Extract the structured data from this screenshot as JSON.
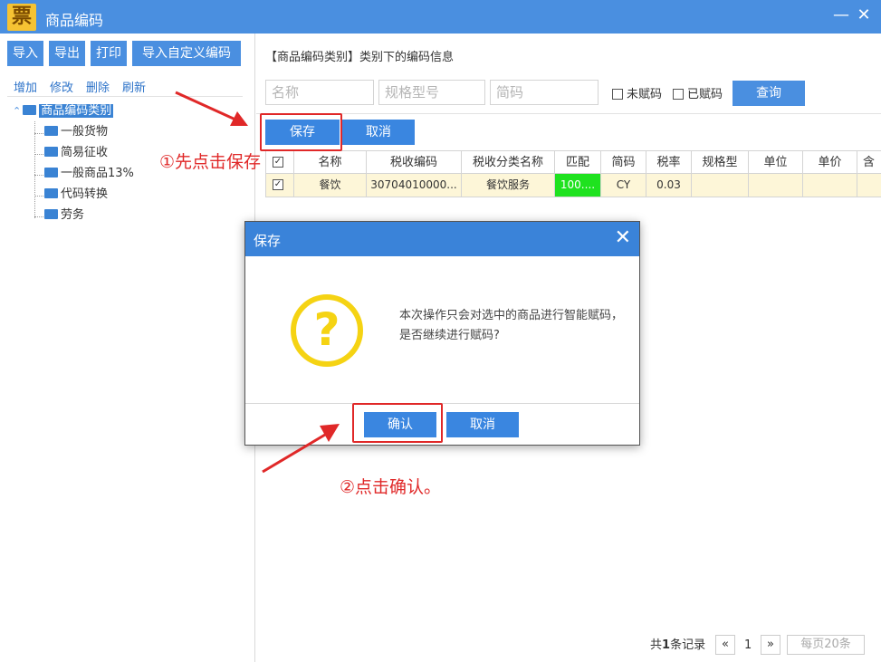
{
  "window": {
    "logo_text": "票",
    "title": "商品编码",
    "minimize": "—",
    "close": "✕"
  },
  "toolbar": {
    "import": "导入",
    "export": "导出",
    "print": "打印",
    "import_custom": "导入自定义编码"
  },
  "actions": {
    "add": "增加",
    "edit": "修改",
    "delete": "删除",
    "refresh": "刷新"
  },
  "tree": {
    "root": "商品编码类别",
    "expander": "⌃",
    "children": [
      "一般货物",
      "简易征收",
      "一般商品13%",
      "代码转换",
      "劳务"
    ]
  },
  "main": {
    "section_title": "【商品编码类别】类别下的编码信息",
    "search": {
      "name_placeholder": "名称",
      "spec_placeholder": "规格型号",
      "short_placeholder": "简码",
      "unassigned_label": "未赋码",
      "assigned_label": "已赋码",
      "query_label": "查询"
    },
    "save_label": "保存",
    "cancel_label": "取消",
    "grid": {
      "columns": [
        "名称",
        "税收编码",
        "税收分类名称",
        "匹配",
        "简码",
        "税率",
        "规格型",
        "单位",
        "单价",
        "含"
      ],
      "rows": [
        {
          "checked": "✓",
          "cells": [
            "餐饮",
            "30704010000...",
            "餐饮服务",
            "100....",
            "CY",
            "0.03",
            "",
            "",
            "",
            ""
          ]
        }
      ],
      "header_check": "✓"
    },
    "pager": {
      "total_prefix": "共",
      "total_count": "1",
      "total_suffix": "条记录",
      "prev": "«",
      "page": "1",
      "next": "»",
      "page_size": "每页20条"
    }
  },
  "dialog": {
    "title": "保存",
    "close": "✕",
    "icon_glyph": "?",
    "message": "本次操作只会对选中的商品进行智能赋码，是否继续进行赋码?",
    "confirm_label": "确认",
    "cancel_label": "取消"
  },
  "annotations": {
    "step1": "①先点击保存",
    "step2": "②点击确认。"
  },
  "colors": {
    "accent": "#4a8fe0",
    "annotation": "#e02828",
    "match": "#1fe21f",
    "selected_row": "#fdf6d8",
    "warning_icon": "#f5d313"
  }
}
